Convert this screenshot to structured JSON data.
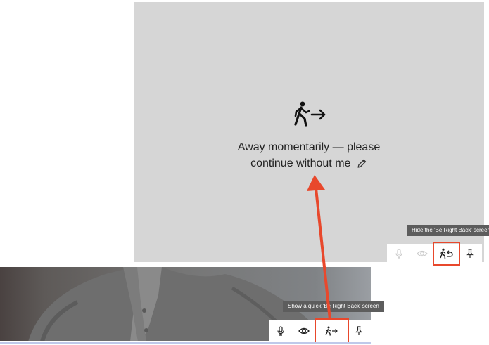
{
  "brb_panel": {
    "icon": "walking-person-arrow-icon",
    "message_line1": "Away momentarily — please",
    "message_line2": "continue without me",
    "edit_icon": "pencil-icon"
  },
  "top_tile": {
    "tooltip": "Hide the 'Be Right Back' screen",
    "toolbar": [
      {
        "icon": "microphone-icon"
      },
      {
        "icon": "eye-icon"
      },
      {
        "icon": "return-person-icon"
      },
      {
        "icon": "pin-icon"
      }
    ]
  },
  "bottom_tile": {
    "tooltip": "Show a quick 'Be Right Back' screen",
    "toolbar": [
      {
        "icon": "microphone-icon"
      },
      {
        "icon": "eye-icon"
      },
      {
        "icon": "walking-person-arrow-icon"
      },
      {
        "icon": "pin-icon"
      }
    ]
  },
  "colors": {
    "highlight": "#e8482c",
    "panel": "#d6d6d6",
    "tooltip": "#5d5d5d"
  }
}
